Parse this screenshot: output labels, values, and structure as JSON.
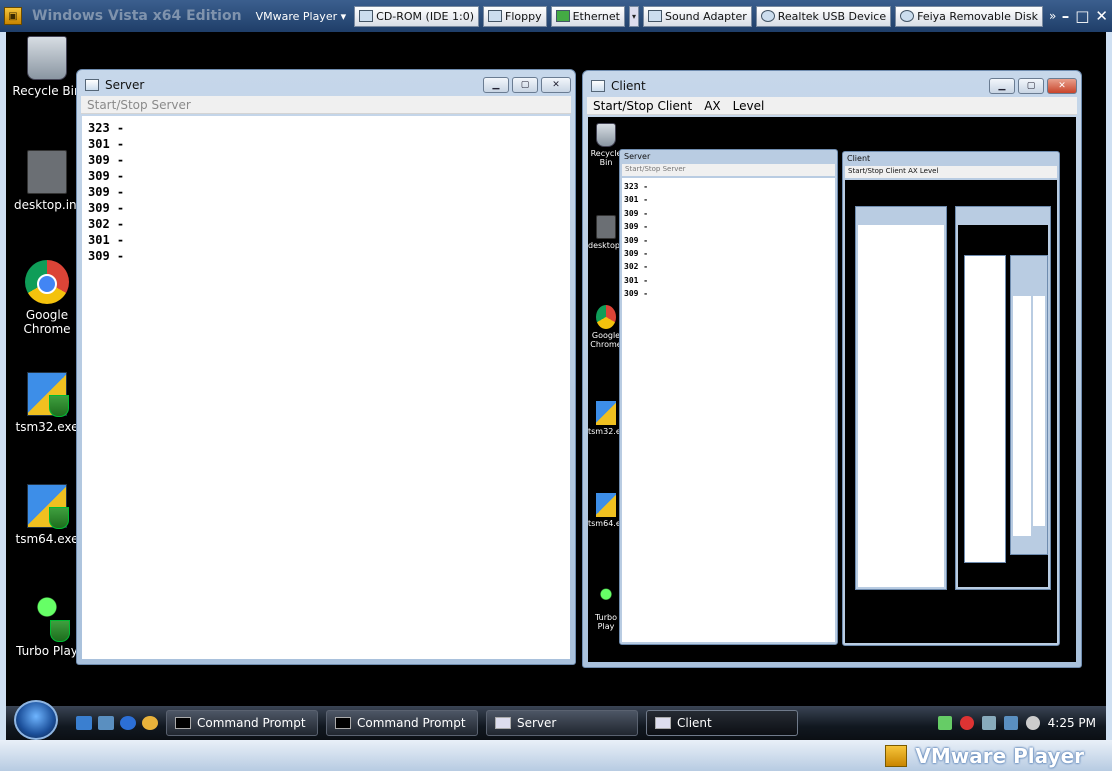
{
  "vmware": {
    "vm_title": "Windows Vista x64 Edition",
    "menu_label": "VMware Player",
    "devices": [
      "CD-ROM (IDE 1:0)",
      "Floppy",
      "Ethernet",
      "Sound Adapter",
      "Realtek USB Device",
      "Feiya Removable Disk"
    ],
    "footer_name": "VMware Player"
  },
  "desktop": {
    "icons": [
      "Recycle Bin",
      "desktop.ini",
      "Google Chrome",
      "tsm32.exe",
      "tsm64.exe",
      "Turbo Play"
    ]
  },
  "server_window": {
    "title": "Server",
    "menu": [
      "Start/Stop Server"
    ],
    "log": [
      "323 -",
      "301 -",
      "309 -",
      "309 -",
      "309 -",
      "309 -",
      "302 -",
      "301 -",
      "309 -"
    ]
  },
  "client_window": {
    "title": "Client",
    "menu": [
      "Start/Stop Client",
      "AX",
      "Level"
    ],
    "nested": {
      "server_title": "Server",
      "server_menu": "Start/Stop Server",
      "client_title": "Client",
      "client_menu": "Start/Stop Client   AX   Level",
      "icons": [
        "Recycle Bin",
        "desktop.ini",
        "Google Chrome",
        "tsm32.exe",
        "tsm64.exe",
        "Turbo Play"
      ]
    }
  },
  "taskbar": {
    "items": [
      "Command Prompt",
      "Command Prompt",
      "Server",
      "Client"
    ],
    "clock": "4:25 PM"
  }
}
